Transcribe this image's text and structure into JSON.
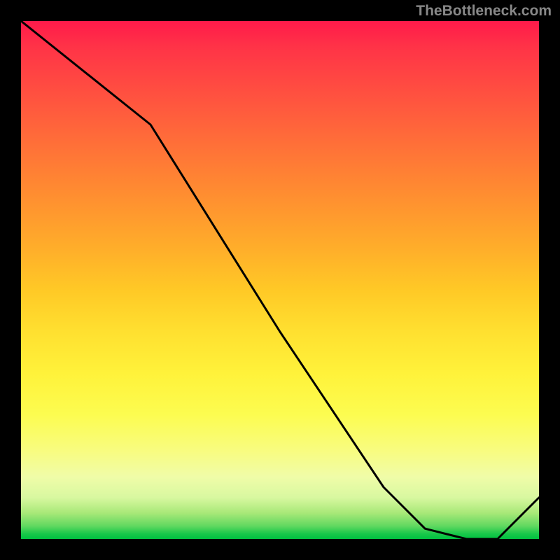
{
  "watermark": "TheBottleneck.com",
  "annotation_label": "",
  "chart_data": {
    "type": "line",
    "title": "",
    "xlabel": "",
    "ylabel": "",
    "x": [
      0.0,
      0.25,
      0.5,
      0.7,
      0.78,
      0.86,
      0.92,
      1.0
    ],
    "values": [
      1.0,
      0.8,
      0.4,
      0.1,
      0.02,
      0.0,
      0.0,
      0.08
    ],
    "xlim": [
      0,
      1
    ],
    "ylim": [
      0,
      1
    ],
    "series_color": "#000000",
    "background": "heatmap-gradient-red-to-green",
    "annotation": {
      "x": 0.88,
      "y": 0.005,
      "text": ""
    }
  }
}
